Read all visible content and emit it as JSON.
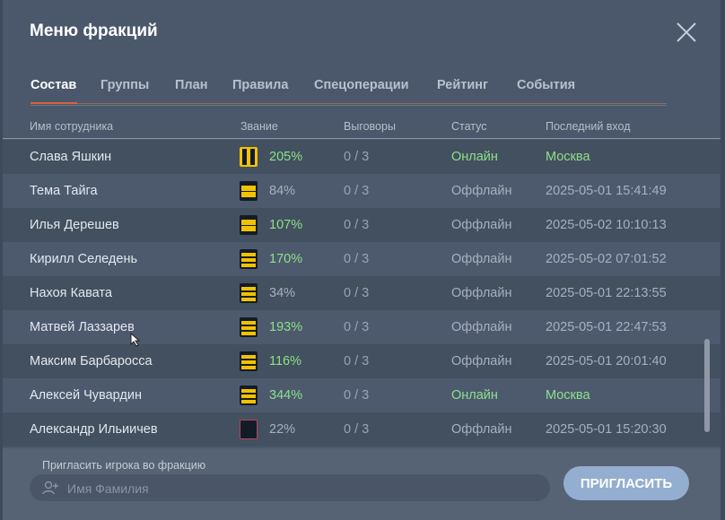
{
  "window": {
    "title": "Меню фракций"
  },
  "tabs": [
    {
      "label": "Состав",
      "active": true
    },
    {
      "label": "Группы"
    },
    {
      "label": "План"
    },
    {
      "label": "Правила"
    },
    {
      "label": "Спецоперации"
    },
    {
      "label": "Рейтинг"
    },
    {
      "label": "События"
    }
  ],
  "columns": {
    "name": "Имя сотрудника",
    "rank": "Звание",
    "warnings": "Выговоры",
    "status": "Статус",
    "last_login": "Последний вход"
  },
  "rows": [
    {
      "name": "Слава Яшкин",
      "rank_icon": "rank-leader-icon",
      "percent": "205%",
      "percent_color": "green",
      "warnings": "0 / 3",
      "status": "Онлайн",
      "last": "Москва",
      "online": true
    },
    {
      "name": "Тема Тайга",
      "rank_icon": "rank-2-stripes-icon",
      "percent": "84%",
      "percent_color": "gray",
      "warnings": "0 / 3",
      "status": "Оффлайн",
      "last": "2025-05-01 15:41:49",
      "online": false
    },
    {
      "name": "Илья Дерешев",
      "rank_icon": "rank-2-stripes-icon",
      "percent": "107%",
      "percent_color": "green",
      "warnings": "0 / 3",
      "status": "Оффлайн",
      "last": "2025-05-02 10:10:13",
      "online": false
    },
    {
      "name": "Кирилл Селедень",
      "rank_icon": "rank-3-stripes-icon",
      "percent": "170%",
      "percent_color": "green",
      "warnings": "0 / 3",
      "status": "Оффлайн",
      "last": "2025-05-02 07:01:52",
      "online": false
    },
    {
      "name": "Нахоя Кавата",
      "rank_icon": "rank-3-stripes-icon",
      "percent": "34%",
      "percent_color": "gray",
      "warnings": "0 / 3",
      "status": "Оффлайн",
      "last": "2025-05-01 22:13:55",
      "online": false
    },
    {
      "name": "Матвей Лаззарев",
      "rank_icon": "rank-3-stripes-icon",
      "percent": "193%",
      "percent_color": "green",
      "warnings": "0 / 3",
      "status": "Оффлайн",
      "last": "2025-05-01 22:47:53",
      "online": false
    },
    {
      "name": "Максим Барбаросса",
      "rank_icon": "rank-3-stripes-icon",
      "percent": "116%",
      "percent_color": "green",
      "warnings": "0 / 3",
      "status": "Оффлайн",
      "last": "2025-05-01 20:01:40",
      "online": false
    },
    {
      "name": "Алексей Чувардин",
      "rank_icon": "rank-3-stripes-icon",
      "percent": "344%",
      "percent_color": "green",
      "warnings": "0 / 3",
      "status": "Онлайн",
      "last": "Москва",
      "online": true
    },
    {
      "name": "Александр Ильиичев",
      "rank_icon": "rank-empty-icon",
      "percent": "22%",
      "percent_color": "gray",
      "warnings": "0 / 3",
      "status": "Оффлайн",
      "last": "2025-05-01 15:20:30",
      "online": false
    }
  ],
  "invite": {
    "label": "Пригласить игрока во фракцию",
    "placeholder": "Имя Фамилия",
    "button": "ПРИГЛАСИТЬ"
  },
  "colors": {
    "background": "#4b586c",
    "online": "#8ee08a",
    "offline": "#a7b0bd",
    "accent_tab": "#e0603a",
    "rank_gold": "#f2c200",
    "button": "#93aed0"
  }
}
